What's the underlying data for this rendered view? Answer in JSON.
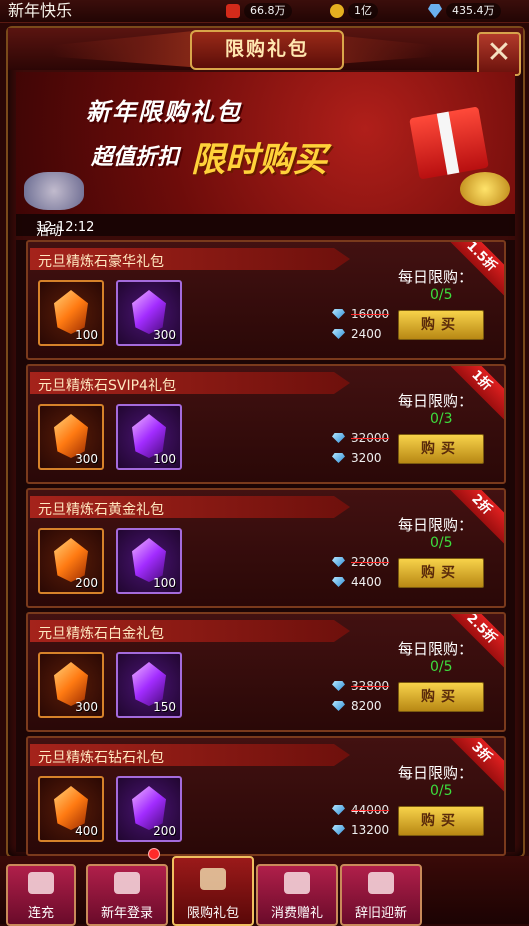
{
  "topbar": {
    "title": "新年快乐",
    "resources": [
      {
        "icon": "vip-level-icon",
        "value": "66.8万",
        "color": "#d42a1a"
      },
      {
        "icon": "gold-coins-icon",
        "value": "1亿",
        "color": "#e6b020"
      },
      {
        "icon": "diamond-icon",
        "value": "435.4万",
        "color": "#6ab0f0"
      }
    ]
  },
  "panel": {
    "title": "限购礼包",
    "close_label": "✕"
  },
  "banner": {
    "line1": "新年限购礼包",
    "line2": "超值折扣",
    "line3": "限时购买",
    "timer_label": "活动倒计时：",
    "timer_value": "12:12:12"
  },
  "cards": [
    {
      "name": "元旦精炼石豪华礼包",
      "item1_qty": "100",
      "item2_qty": "300",
      "original_price": "16000",
      "price": "2400",
      "limit_label": "每日限购：",
      "limit_count": "0/5",
      "buy_label": "购买",
      "discount": "1.5折"
    },
    {
      "name": "元旦精炼石SVIP4礼包",
      "item1_qty": "300",
      "item2_qty": "100",
      "original_price": "32000",
      "price": "3200",
      "limit_label": "每日限购：",
      "limit_count": "0/3",
      "buy_label": "购买",
      "discount": "1折"
    },
    {
      "name": "元旦精炼石黄金礼包",
      "item1_qty": "200",
      "item2_qty": "100",
      "original_price": "22000",
      "price": "4400",
      "limit_label": "每日限购：",
      "limit_count": "0/5",
      "buy_label": "购买",
      "discount": "2折"
    },
    {
      "name": "元旦精炼石白金礼包",
      "item1_qty": "300",
      "item2_qty": "150",
      "original_price": "32800",
      "price": "8200",
      "limit_label": "每日限购：",
      "limit_count": "0/5",
      "buy_label": "购买",
      "discount": "2.5折"
    },
    {
      "name": "元旦精炼石钻石礼包",
      "item1_qty": "400",
      "item2_qty": "200",
      "original_price": "44000",
      "price": "13200",
      "limit_label": "每日限购：",
      "limit_count": "0/5",
      "buy_label": "购买",
      "discount": "3折"
    }
  ],
  "tabs": [
    {
      "label": "连充",
      "icon": "recharge-icon"
    },
    {
      "label": "新年登录",
      "icon": "gift-box-icon"
    },
    {
      "label": "限购礼包",
      "icon": "gift-basket-icon",
      "active": true
    },
    {
      "label": "消费赠礼",
      "icon": "treasure-chest-icon"
    },
    {
      "label": "辞旧迎新",
      "icon": "fireworks-icon"
    }
  ]
}
